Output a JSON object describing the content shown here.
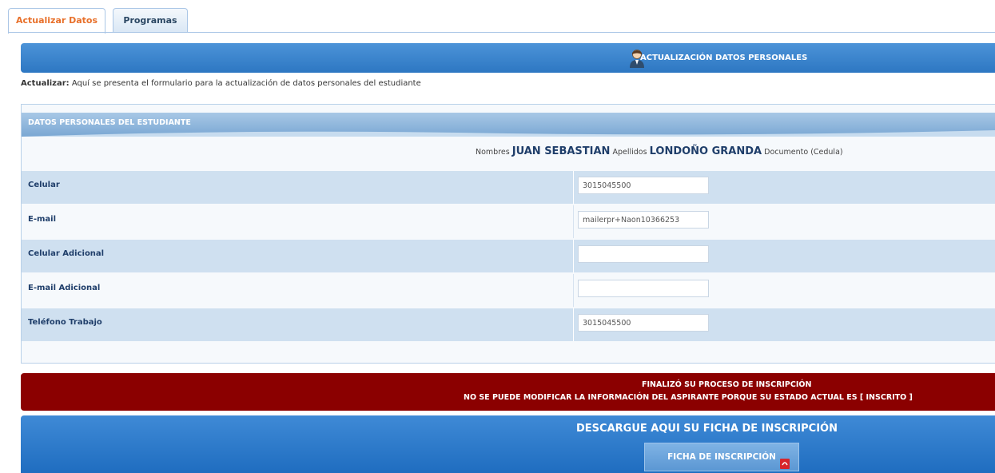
{
  "tabs": [
    {
      "label": "Actualizar Datos",
      "active": true
    },
    {
      "label": "Programas",
      "active": false
    }
  ],
  "section": {
    "title": "ACTUALIZACIÓN DATOS PERSONALES",
    "icon": "user-icon"
  },
  "intro": {
    "bold": "Actualizar:",
    "text": " Aquí se presenta el formulario para la actualización de datos personales del estudiante"
  },
  "panel": {
    "title": "DATOS PERSONALES DEL ESTUDIANTE",
    "person": {
      "nombres_label": "Nombres",
      "nombres": "JUAN SEBASTIAN",
      "apellidos_label": "Apellidos",
      "apellidos": "LONDOÑO GRANDA",
      "documento_label": "Documento (Cedula)"
    },
    "fields": [
      {
        "label": "Celular",
        "value": "3015045500"
      },
      {
        "label": "E-mail",
        "value": "mailerpr+Naon10366253"
      },
      {
        "label": "Celular Adicional",
        "value": ""
      },
      {
        "label": "E-mail Adicional",
        "value": ""
      },
      {
        "label": "Teléfono Trabajo",
        "value": "3015045500"
      }
    ]
  },
  "alert": {
    "line1": "FINALIZÓ SU PROCESO DE INSCRIPCIÓN",
    "line2": "NO SE PUEDE MODIFICAR LA INFORMACIÓN DEL ASPIRANTE PORQUE SU ESTADO ACTUAL ES [ INSCRITO ]"
  },
  "download": {
    "title": "DESCARGUE AQUI SU FICHA DE INSCRIPCIÓN",
    "button": "FICHA DE INSCRIPCIÓN",
    "button_icon": "pdf-icon"
  },
  "colors": {
    "accent_tab": "#e8702a",
    "header_blue": "#2d77c2",
    "row_shade": "#cfe0f0",
    "alert_red": "#8b0000"
  }
}
